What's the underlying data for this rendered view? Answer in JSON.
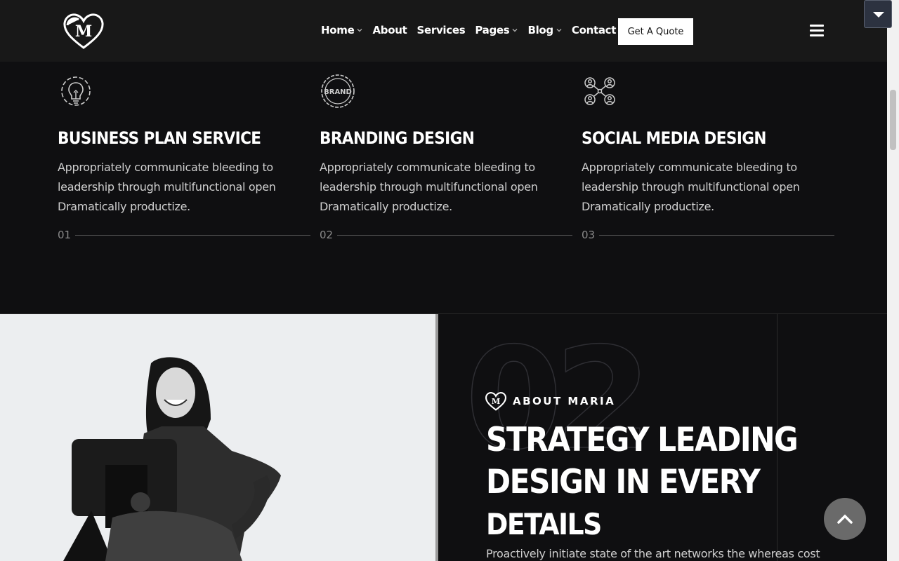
{
  "header": {
    "nav": [
      {
        "label": "Home",
        "has_dropdown": true
      },
      {
        "label": "About",
        "has_dropdown": false
      },
      {
        "label": "Services",
        "has_dropdown": false
      },
      {
        "label": "Pages",
        "has_dropdown": true
      },
      {
        "label": "Blog",
        "has_dropdown": true
      },
      {
        "label": "Contact",
        "has_dropdown": false
      }
    ],
    "cta_label": "Get A Quote"
  },
  "services": [
    {
      "icon": "lightbulb-gear-icon",
      "title": "BUSINESS PLAN SERVICE",
      "description": "Appropriately communicate bleeding to leadership through multifunctional open Dramatically productize.",
      "number": "01"
    },
    {
      "icon": "brand-badge-icon",
      "title": "BRANDING DESIGN",
      "description": "Appropriately communicate bleeding to leadership through multifunctional open Dramatically productize.",
      "number": "02"
    },
    {
      "icon": "network-users-icon",
      "title": "SOCIAL MEDIA DESIGN",
      "description": "Appropriately communicate bleeding to leadership through multifunctional open Dramatically productize.",
      "number": "03"
    }
  ],
  "brand_icon_text": "BRAND",
  "about": {
    "big_number": "02",
    "tag": "ABOUT MARIA",
    "title_lines": [
      "STRATEGY LEADING",
      "DESIGN IN EVERY",
      "DETAILS"
    ],
    "text": "Proactively initiate state of the art networks the whereas cost"
  },
  "colors": {
    "background": "#0f0f11",
    "header": "#181818",
    "accent": "#ffffff"
  }
}
